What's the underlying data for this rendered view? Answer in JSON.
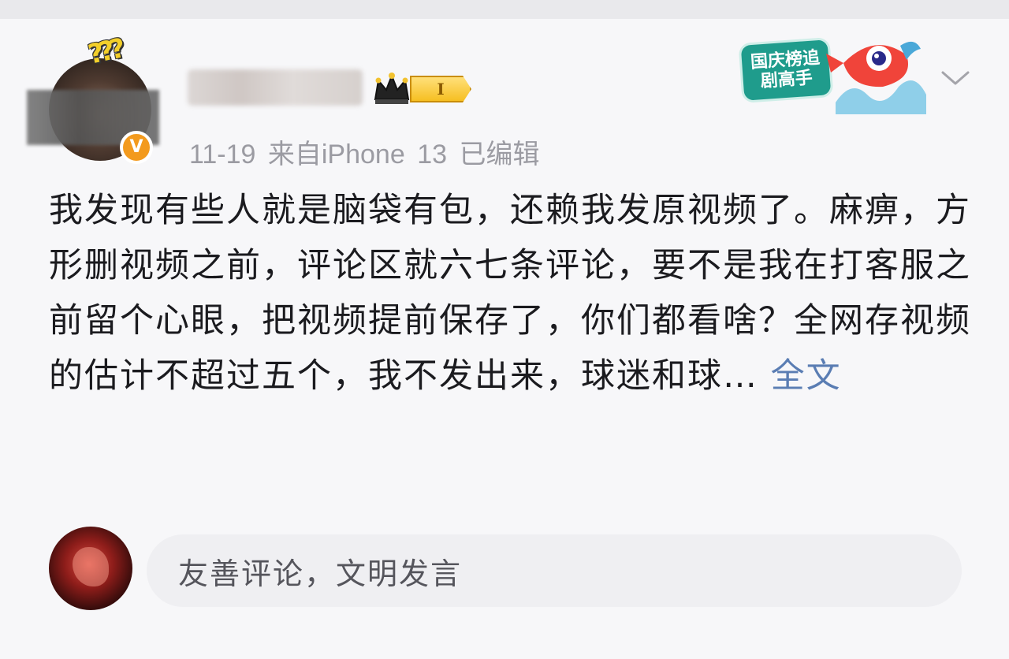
{
  "post": {
    "author_level": "I",
    "meta": "11-19 来自iPhone 13 已编辑",
    "body": "我发现有些人就是脑袋有包，还赖我发原视频了。麻痹，方形删视频之前，评论区就六七条评论，要不是我在打客服之前留个心眼，把视频提前保存了，你们都看啥？全网存视频的估计不超过五个，我不发出来，球迷和球…",
    "expand_label": "全文",
    "medal_text": "国庆榜追剧高手"
  },
  "comment": {
    "placeholder": "友善评论，文明发言"
  },
  "colors": {
    "verified_badge": "#f39a1d",
    "level_badge": "#f6bf22",
    "link": "#5a7db3",
    "meta_text": "#9b9ba2"
  },
  "icons": {
    "verified": "verified-v-icon",
    "crown": "crown-icon",
    "expand": "chevron-down-icon"
  }
}
